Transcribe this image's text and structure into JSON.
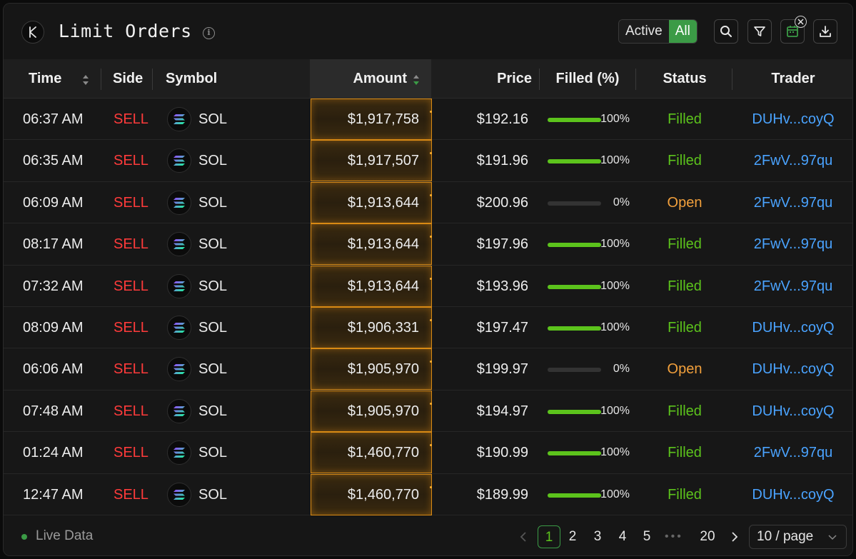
{
  "header": {
    "title": "Limit Orders",
    "toggle_active": "Active",
    "toggle_all": "All"
  },
  "columns": {
    "time": "Time",
    "side": "Side",
    "symbol": "Symbol",
    "amount": "Amount",
    "price": "Price",
    "filled": "Filled (%)",
    "status": "Status",
    "trader": "Trader"
  },
  "rows": [
    {
      "time": "06:37 AM",
      "side": "SELL",
      "symbol": "SOL",
      "amount": "$1,917,758",
      "price": "$192.16",
      "filled": 100,
      "filled_label": "100%",
      "status": "Filled",
      "trader": "DUHv...coyQ"
    },
    {
      "time": "06:35 AM",
      "side": "SELL",
      "symbol": "SOL",
      "amount": "$1,917,507",
      "price": "$191.96",
      "filled": 100,
      "filled_label": "100%",
      "status": "Filled",
      "trader": "2FwV...97qu"
    },
    {
      "time": "06:09 AM",
      "side": "SELL",
      "symbol": "SOL",
      "amount": "$1,913,644",
      "price": "$200.96",
      "filled": 0,
      "filled_label": "0%",
      "status": "Open",
      "trader": "2FwV...97qu"
    },
    {
      "time": "08:17 AM",
      "side": "SELL",
      "symbol": "SOL",
      "amount": "$1,913,644",
      "price": "$197.96",
      "filled": 100,
      "filled_label": "100%",
      "status": "Filled",
      "trader": "2FwV...97qu"
    },
    {
      "time": "07:32 AM",
      "side": "SELL",
      "symbol": "SOL",
      "amount": "$1,913,644",
      "price": "$193.96",
      "filled": 100,
      "filled_label": "100%",
      "status": "Filled",
      "trader": "2FwV...97qu"
    },
    {
      "time": "08:09 AM",
      "side": "SELL",
      "symbol": "SOL",
      "amount": "$1,906,331",
      "price": "$197.47",
      "filled": 100,
      "filled_label": "100%",
      "status": "Filled",
      "trader": "DUHv...coyQ"
    },
    {
      "time": "06:06 AM",
      "side": "SELL",
      "symbol": "SOL",
      "amount": "$1,905,970",
      "price": "$199.97",
      "filled": 0,
      "filled_label": "0%",
      "status": "Open",
      "trader": "DUHv...coyQ"
    },
    {
      "time": "07:48 AM",
      "side": "SELL",
      "symbol": "SOL",
      "amount": "$1,905,970",
      "price": "$194.97",
      "filled": 100,
      "filled_label": "100%",
      "status": "Filled",
      "trader": "DUHv...coyQ"
    },
    {
      "time": "01:24 AM",
      "side": "SELL",
      "symbol": "SOL",
      "amount": "$1,460,770",
      "price": "$190.99",
      "filled": 100,
      "filled_label": "100%",
      "status": "Filled",
      "trader": "2FwV...97qu"
    },
    {
      "time": "12:47 AM",
      "side": "SELL",
      "symbol": "SOL",
      "amount": "$1,460,770",
      "price": "$189.99",
      "filled": 100,
      "filled_label": "100%",
      "status": "Filled",
      "trader": "DUHv...coyQ"
    }
  ],
  "footer": {
    "live_label": "Live Data",
    "pages": [
      "1",
      "2",
      "3",
      "4",
      "5"
    ],
    "last_page": "20",
    "current_page": "1",
    "page_size": "10 / page"
  },
  "colors": {
    "accent": "#3b9b46",
    "sell": "#ff3b3b",
    "filled": "#5cc31c",
    "open": "#f2a03c",
    "trader_link": "#4aa3ff",
    "amount_highlight": "#d98a14"
  },
  "icons": {
    "logo": "k-logo-icon",
    "info": "info-icon",
    "search": "search-icon",
    "filter": "filter-icon",
    "calendar": "calendar-icon",
    "download": "download-icon",
    "close": "close-icon",
    "symbol": "solana-icon"
  }
}
